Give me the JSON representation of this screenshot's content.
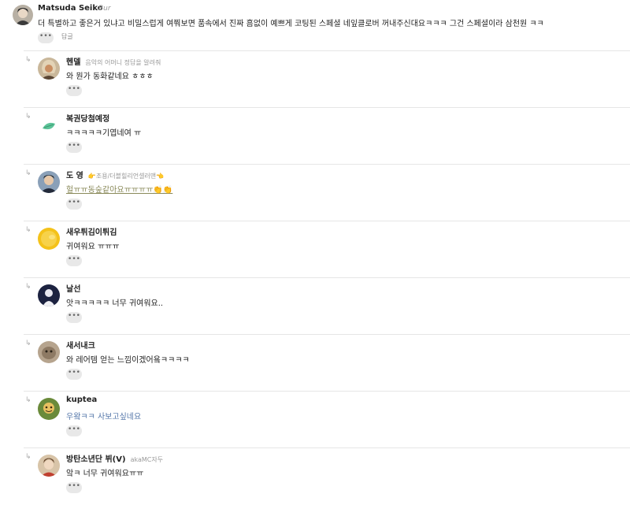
{
  "main_comment": {
    "author": "Matsuda Seiko",
    "badge": "Bur",
    "text": "더 특별하고 좋은거 있냐고 비밀스럽게 여쭤보면 품속에서 진짜 흠없이 예쁘게 코팅된 스페셜 네잎클로버 꺼내주신대요ㅋㅋㅋ 그건 스페셜이라 삼천원 ㅋㅋ",
    "more_label": "•••",
    "reply_label": "답글"
  },
  "replies": [
    {
      "author": "헨델",
      "badge": "음악의 어머니 정답을 알려줘",
      "text": "와 뭔가 동화같네요 ㅎㅎㅎ",
      "more_label": "•••"
    },
    {
      "author": "복권당첨예정",
      "badge": "",
      "text": "ㅋㅋㅋㅋㅋ기엽네여 ㅠ",
      "more_label": "•••"
    },
    {
      "author": "도 영",
      "badge": "👉조용/더블힐리언셀러맨👈",
      "text": "헐ㅠㅠ동숲같아요ㅠㅠㅠㅠ👏👏",
      "more_label": "•••"
    },
    {
      "author": "새우튀김이튀김",
      "badge": "",
      "text": "귀여워요 ㅠㅠㅠ",
      "more_label": "•••"
    },
    {
      "author": "날선",
      "badge": "",
      "text": "앗ㅋㅋㅋㅋㅋ 너무 귀여워요..",
      "more_label": "•••"
    },
    {
      "author": "새서내크",
      "badge": "",
      "text": "와 레어템 얻는 느낌이겠어욬ㅋㅋㅋㅋ",
      "more_label": "•••"
    },
    {
      "author": "kuptea",
      "badge": "",
      "text": "우왘ㅋㅋ 사보고싶네요",
      "more_label": "•••"
    },
    {
      "author": "방탄소년단 뷔(V)",
      "badge": "akaMC자두",
      "text": "앜ㅋ 너무 귀여워요ㅠㅠ",
      "more_label": "•••"
    }
  ],
  "colors": {
    "divider": "#e6e6e6",
    "link_text": "#8a8a5a",
    "blue_text": "#5577aa"
  }
}
